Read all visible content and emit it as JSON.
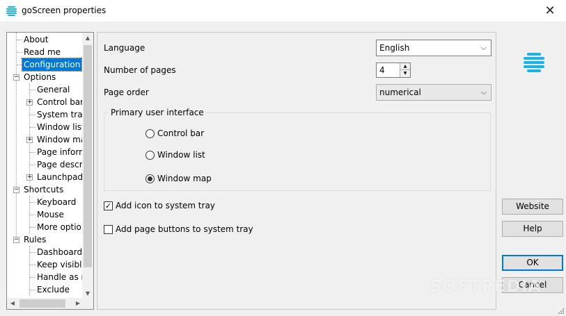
{
  "window": {
    "title": "goScreen properties",
    "close_glyph": "✕"
  },
  "tree": {
    "items": [
      {
        "label": "About"
      },
      {
        "label": "Read me"
      },
      {
        "label": "Configuration",
        "selected": true
      },
      {
        "label": "Options",
        "expanded": true
      },
      {
        "label": "General"
      },
      {
        "label": "Control bar",
        "collapsed": true
      },
      {
        "label": "System tray"
      },
      {
        "label": "Window list"
      },
      {
        "label": "Window ma",
        "collapsed": true
      },
      {
        "label": "Page inform"
      },
      {
        "label": "Page descrip"
      },
      {
        "label": "Launchpad",
        "collapsed": true
      },
      {
        "label": "Shortcuts",
        "expanded": true
      },
      {
        "label": "Keyboard"
      },
      {
        "label": "Mouse"
      },
      {
        "label": "More option"
      },
      {
        "label": "Rules",
        "expanded": true
      },
      {
        "label": "Dashboard"
      },
      {
        "label": "Keep visible"
      },
      {
        "label": "Handle as m"
      },
      {
        "label": "Exclude"
      }
    ],
    "expander_minus": "−",
    "expander_plus": "+"
  },
  "config": {
    "language_label": "Language",
    "language_value": "English",
    "pages_label": "Number of pages",
    "pages_value": "4",
    "order_label": "Page order",
    "order_value": "numerical",
    "ui_group_title": "Primary user interface",
    "radio_options": [
      {
        "label": "Control bar",
        "checked": false
      },
      {
        "label": "Window list",
        "checked": false
      },
      {
        "label": "Window map",
        "checked": true
      }
    ],
    "tray_icon_label": "Add icon to system tray",
    "tray_icon_checked": true,
    "tray_buttons_label": "Add page buttons to system tray",
    "tray_buttons_checked": false
  },
  "buttons": {
    "website": "Website",
    "help": "Help",
    "ok": "OK",
    "cancel": "Cancel"
  },
  "watermark": "SOFTPEDIA",
  "colors": {
    "accent": "#0078d7",
    "logo": "#1ab3e6"
  }
}
